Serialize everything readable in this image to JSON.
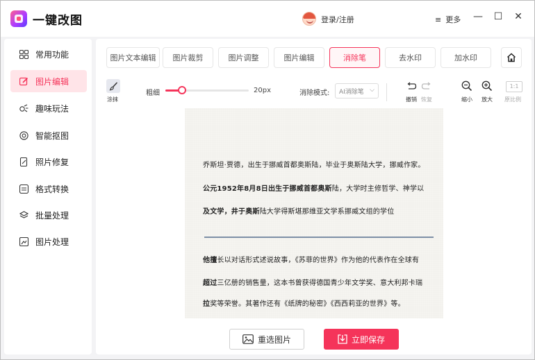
{
  "app": {
    "title": "一键改图"
  },
  "header": {
    "login": "登录/注册",
    "more": "更多",
    "more_icon": "≡"
  },
  "window_controls": {
    "minimize": "—",
    "maximize": "☐",
    "close": "✕"
  },
  "sidebar": {
    "items": [
      {
        "label": "常用功能",
        "icon": "grid-icon"
      },
      {
        "label": "图片编辑",
        "icon": "edit-icon",
        "active": true
      },
      {
        "label": "趣味玩法",
        "icon": "fun-icon"
      },
      {
        "label": "智能抠图",
        "icon": "target-icon"
      },
      {
        "label": "照片修复",
        "icon": "repair-icon"
      },
      {
        "label": "格式转换",
        "icon": "convert-icon"
      },
      {
        "label": "批量处理",
        "icon": "layers-icon"
      },
      {
        "label": "图片处理",
        "icon": "image-icon"
      }
    ]
  },
  "tabs": [
    "图片文本编辑",
    "图片裁剪",
    "图片调整",
    "图片编辑",
    "消除笔",
    "去水印",
    "加水印"
  ],
  "active_tab": "消除笔",
  "toolbar": {
    "brush_label": "涂抹",
    "thickness_label": "粗细",
    "thickness_value": "20px",
    "thickness_fraction": 0.2,
    "mode_label": "消除模式:",
    "mode_value": "AI消除笔",
    "undo": "撤销",
    "redo": "恢复",
    "zoom_out": "缩小",
    "zoom_in": "放大",
    "ratio": "1:1",
    "original_ratio": "原比例"
  },
  "document": {
    "line1": "乔斯坦·贾德，出生于挪威首都奥斯陆，毕业于奥斯陆大学，挪威作家。",
    "line2_bold": "公元1952年8月8日出生于挪威首都奥斯",
    "line2_rest": "陆，大学时主修哲学、神学以",
    "line3_bold": "及文学，井于奥斯",
    "line3_rest": "陆大学得斯堪那维亚文学系挪威文组的学位",
    "line4_bold": "他擅",
    "line4_rest": "长以对话形式述说故事，《苏菲的世界》作为他的代表作在全球有",
    "line5_bold": "超过",
    "line5_rest": "三亿册的销售量，这本书曾获得德国青少年文学奖、意大利邦卡瑞",
    "line6_bold": "拉",
    "line6_rest": "奖等荣誉。其著作还有《纸牌的秘密》《西西莉亚的世界》等。"
  },
  "actions": {
    "reselect": "重选图片",
    "save": "立即保存"
  },
  "colors": {
    "accent": "#f5345a",
    "active_bg": "#ffe4e8"
  }
}
